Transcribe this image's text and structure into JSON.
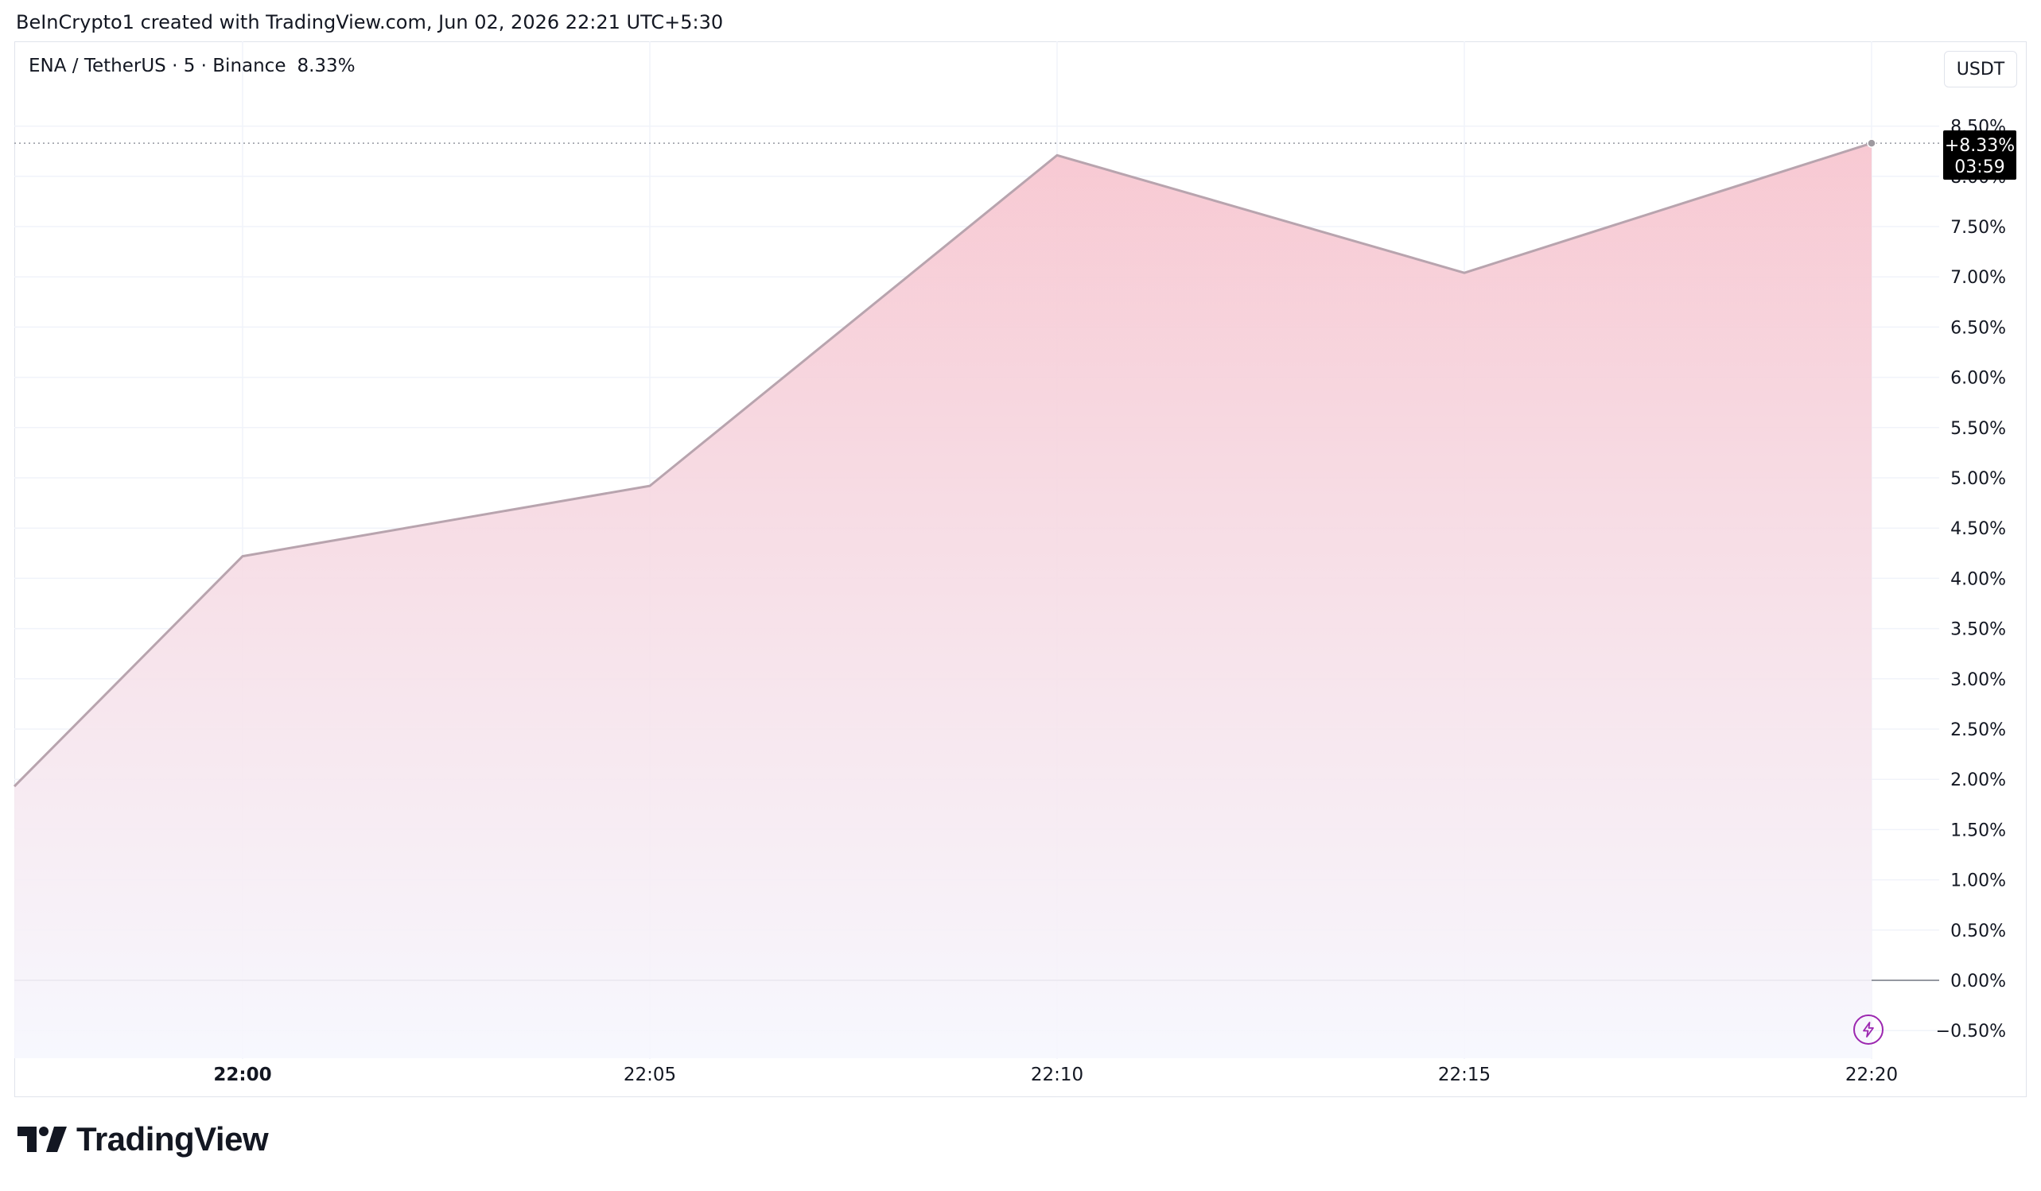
{
  "header": {
    "attribution": "BeInCrypto1 created with TradingView.com, Jun 02, 2026 22:21 UTC+5:30"
  },
  "legend": {
    "symbol": "ENA / TetherUS · 5 · Binance",
    "change": "8.33%"
  },
  "currency_button": "USDT",
  "last_value_label": {
    "value": "+8.33%",
    "countdown": "03:59"
  },
  "logo": {
    "text": "TradingView",
    "icon": "tradingview-logo-icon"
  },
  "icons": {
    "lightning": "lightning-icon"
  },
  "colors": {
    "line": "#b8a4ae",
    "fill_top": "#f7c6d0",
    "fill_bottom": "#f6f7fe",
    "label_bg": "#000000",
    "accent": "#9c27b0",
    "zero_line": "#9598a1"
  },
  "chart_data": {
    "type": "area",
    "title": "",
    "x": [
      "21:58",
      "22:00",
      "22:05",
      "22:10",
      "22:15",
      "22:20"
    ],
    "values": [
      1.93,
      4.22,
      4.92,
      8.21,
      7.04,
      8.33
    ],
    "series": [
      {
        "values": [
          1.93,
          4.22,
          4.92,
          8.21,
          7.04,
          8.33
        ]
      }
    ],
    "xticks": [
      "22:00",
      "22:05",
      "22:10",
      "22:15",
      "22:20"
    ],
    "yticks": [
      "8.50%",
      "8.00%",
      "7.50%",
      "7.00%",
      "6.50%",
      "6.00%",
      "5.50%",
      "5.00%",
      "4.50%",
      "4.00%",
      "3.50%",
      "3.00%",
      "2.50%",
      "2.00%",
      "1.50%",
      "1.00%",
      "0.50%",
      "0.00%",
      "−0.50%"
    ],
    "ytick_values": [
      8.5,
      8.0,
      7.5,
      7.0,
      6.5,
      6.0,
      5.5,
      5.0,
      4.5,
      4.0,
      3.5,
      3.0,
      2.5,
      2.0,
      1.5,
      1.0,
      0.5,
      0.0,
      -0.5
    ],
    "ylim": [
      -0.8,
      9.0
    ],
    "y_unit": "%",
    "grid": true,
    "axis_position": "right"
  }
}
